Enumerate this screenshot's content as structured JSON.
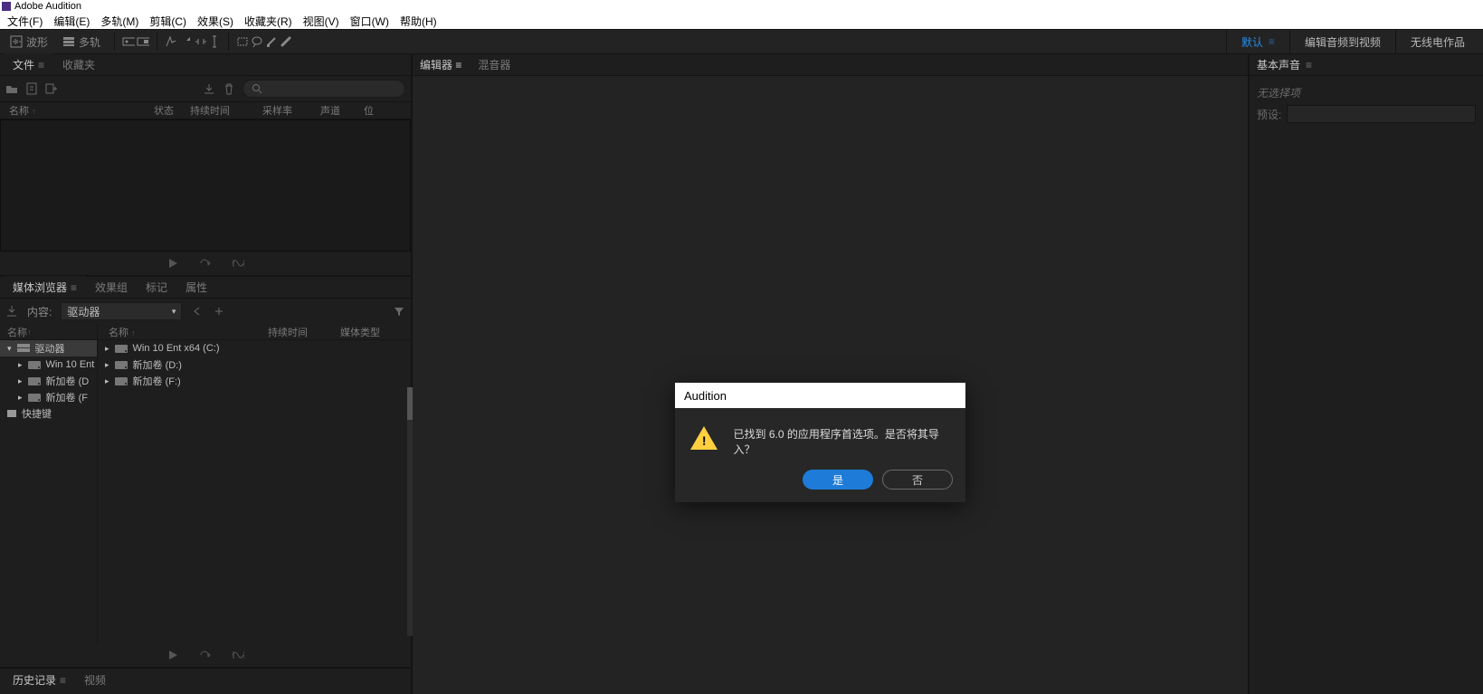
{
  "app_title": "Adobe Audition",
  "menubar": [
    "文件(F)",
    "编辑(E)",
    "多轨(M)",
    "剪辑(C)",
    "效果(S)",
    "收藏夹(R)",
    "视图(V)",
    "窗口(W)",
    "帮助(H)"
  ],
  "toolbar": {
    "waveform": "波形",
    "multitrack": "多轨"
  },
  "workspaces": {
    "active": "默认",
    "items": [
      "默认",
      "编辑音频到视频",
      "无线电作品"
    ]
  },
  "files_panel": {
    "tabs": [
      "文件",
      "收藏夹"
    ],
    "headers": {
      "name": "名称",
      "status": "状态",
      "duration": "持续时间",
      "sample_rate": "采样率",
      "channels": "声道",
      "bit": "位"
    }
  },
  "media_panel": {
    "tabs": [
      "媒体浏览器",
      "效果组",
      "标记",
      "属性"
    ],
    "content_label": "内容:",
    "dropdown": "驱动器",
    "tree": {
      "header": "名称",
      "root": "驱动器",
      "drives": [
        "Win 10 Ent (C:)",
        "新加卷 (D:)",
        "新加卷 (F:)"
      ],
      "drives_short": [
        "Win 10 Ent",
        "新加卷 (D",
        "新加卷 (F"
      ],
      "shortcuts": "快捷键"
    },
    "list_headers": {
      "name": "名称",
      "duration": "持续时间",
      "type": "媒体类型"
    },
    "list_items": [
      "Win 10 Ent x64 (C:)",
      "新加卷 (D:)",
      "新加卷 (F:)"
    ]
  },
  "history_panel": {
    "tabs": [
      "历史记录",
      "视频"
    ]
  },
  "center": {
    "tabs": [
      "编辑器",
      "混音器"
    ]
  },
  "right_panel": {
    "title": "基本声音",
    "no_selection": "无选择项",
    "preset_label": "预设:"
  },
  "dialog": {
    "title": "Audition",
    "message": "已找到  6.0 的应用程序首选项。是否将其导入？",
    "yes": "是",
    "no": "否"
  }
}
